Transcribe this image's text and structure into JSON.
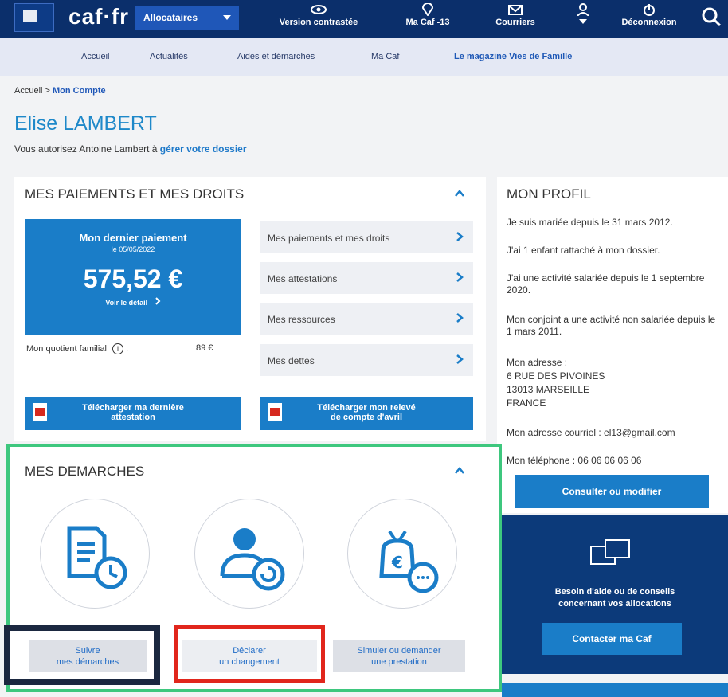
{
  "topbar": {
    "logo_text": "caf·fr",
    "allocataires": "Allocataires",
    "version_contrastee": "Version contrastée",
    "ma_caf": "Ma Caf -13",
    "courriers": "Courriers",
    "deconnexion": "Déconnexion"
  },
  "subnav": {
    "accueil": "Accueil",
    "actualites": "Actualités",
    "aides": "Aides et démarches",
    "ma_caf": "Ma Caf",
    "magazine": "Le magazine Vies de Famille"
  },
  "breadcrumb": {
    "home": "Accueil",
    "sep": " > ",
    "current": "Mon Compte"
  },
  "user": {
    "name": "Elise LAMBERT",
    "auth_text": "Vous autorisez Antoine Lambert à ",
    "auth_link": "gérer votre dossier"
  },
  "paiements": {
    "title": "MES PAIEMENTS ET MES DROITS",
    "dernier_label": "Mon dernier paiement",
    "dernier_date": "le 05/05/2022",
    "amount": "575,52 €",
    "voir_detail": "Voir le détail",
    "menu": [
      "Mes paiements et mes droits",
      "Mes attestations",
      "Mes ressources",
      "Mes dettes"
    ],
    "qf_label": "Mon quotient familial",
    "qf_info": "i",
    "qf_sep": ":",
    "qf_value": "89 €",
    "dl_attestation": [
      "Télécharger ma dernière",
      "attestation"
    ],
    "dl_releve": [
      "Télécharger mon relevé",
      "de compte d'avril"
    ]
  },
  "profil": {
    "title": "MON PROFIL",
    "lines": [
      "Je suis mariée depuis le 31 mars 2012.",
      "J'ai 1 enfant rattaché à mon dossier.",
      "J'ai une activité salariée depuis le 1 septembre 2020.",
      "Mon conjoint a une activité non salariée depuis le 1 mars 2011.",
      "Mon adresse :",
      "6 RUE DES PIVOINES",
      "13013 MARSEILLE",
      "FRANCE",
      "Mon adresse courriel : el13@gmail.com",
      "Mon téléphone : 06 06 06 06 06"
    ],
    "consult_button": "Consulter ou modifier"
  },
  "help": {
    "message": [
      "Besoin d'aide ou de conseils",
      "concernant vos allocations"
    ],
    "button": "Contacter ma Caf"
  },
  "demarches": {
    "title": "MES DEMARCHES",
    "buttons": [
      [
        "Suivre",
        "mes démarches"
      ],
      [
        "Déclarer",
        "un changement"
      ],
      [
        "Simuler ou demander",
        "une prestation"
      ]
    ]
  },
  "colors": {
    "brand_dark": "#0b2f6b",
    "brand_blue": "#1a7dc8",
    "highlight_green": "#3ec77e",
    "highlight_red": "#e1261c",
    "highlight_dark": "#1b2840"
  }
}
